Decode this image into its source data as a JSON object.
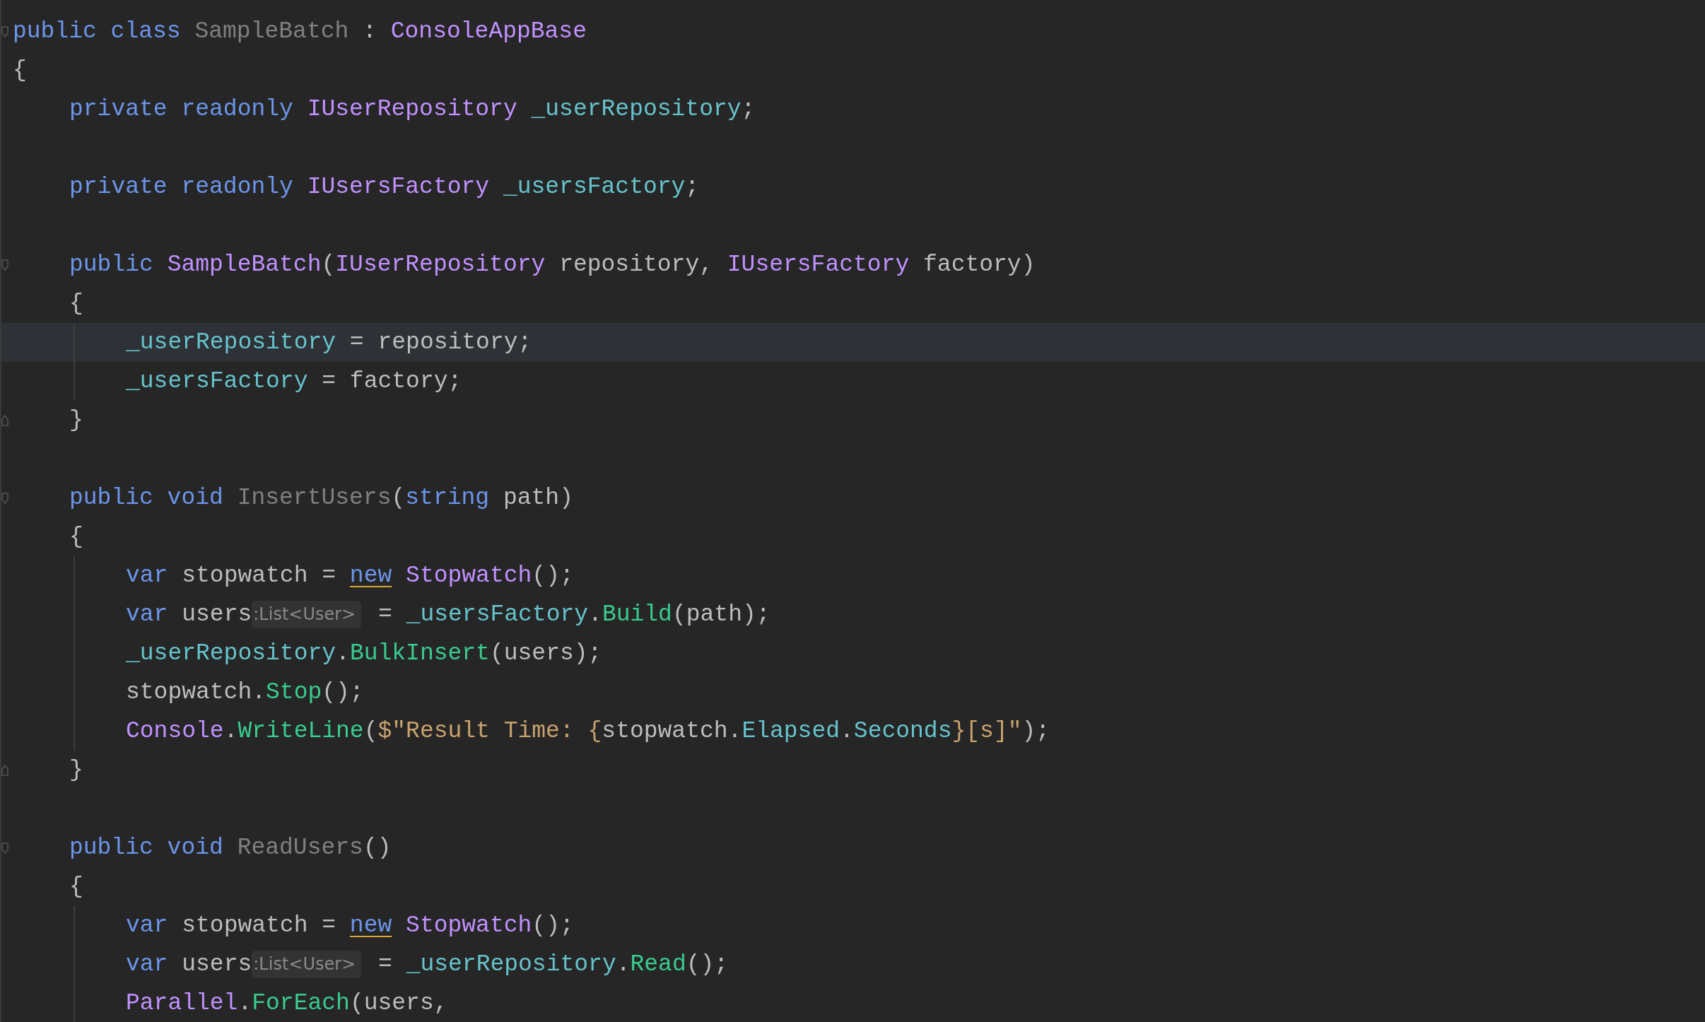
{
  "lines": [
    {
      "kind": "code",
      "fold_open": true,
      "tokens": [
        {
          "text": "public class ",
          "kind": "keyword"
        },
        {
          "text": "SampleBatch",
          "kind": "unused"
        },
        {
          "text": " : ",
          "kind": "plain"
        },
        {
          "text": "ConsoleAppBase",
          "kind": "type"
        }
      ]
    },
    {
      "kind": "code",
      "tokens": [
        {
          "text": "{",
          "kind": "plain"
        }
      ],
      "children": [
        {
          "kind": "code",
          "tokens": [
            {
              "text": "private readonly ",
              "kind": "keyword"
            },
            {
              "text": "IUserRepository ",
              "kind": "type"
            },
            {
              "text": "_userRepository",
              "kind": "field"
            },
            {
              "text": ";",
              "kind": "plain"
            }
          ]
        },
        {
          "kind": "blank"
        },
        {
          "kind": "code",
          "tokens": [
            {
              "text": "private readonly ",
              "kind": "keyword"
            },
            {
              "text": "IUsersFactory ",
              "kind": "type"
            },
            {
              "text": "_usersFactory",
              "kind": "field"
            },
            {
              "text": ";",
              "kind": "plain"
            }
          ]
        },
        {
          "kind": "blank"
        },
        {
          "kind": "code",
          "fold_open": true,
          "tokens": [
            {
              "text": "public ",
              "kind": "keyword"
            },
            {
              "text": "SampleBatch",
              "kind": "type"
            },
            {
              "text": "(",
              "kind": "plain"
            },
            {
              "text": "IUserRepository",
              "kind": "type"
            },
            {
              "text": " repository, ",
              "kind": "plain"
            },
            {
              "text": "IUsersFactory",
              "kind": "type"
            },
            {
              "text": " factory)",
              "kind": "plain"
            }
          ]
        },
        {
          "kind": "code",
          "tokens": [
            {
              "text": "{",
              "kind": "plain"
            }
          ],
          "children": [
            {
              "kind": "code",
              "selected": true,
              "tokens": [
                {
                  "text": "_userRepository",
                  "kind": "field"
                },
                {
                  "text": " = repository;",
                  "kind": "plain"
                }
              ]
            },
            {
              "kind": "code",
              "tokens": [
                {
                  "text": "_usersFactory",
                  "kind": "field"
                },
                {
                  "text": " = factory;",
                  "kind": "plain"
                }
              ]
            }
          ]
        },
        {
          "kind": "code",
          "fold_close": true,
          "tokens": [
            {
              "text": "}",
              "kind": "plain"
            }
          ]
        },
        {
          "kind": "blank"
        },
        {
          "kind": "code",
          "fold_open": true,
          "tokens": [
            {
              "text": "public void ",
              "kind": "keyword"
            },
            {
              "text": "InsertUsers",
              "kind": "unused"
            },
            {
              "text": "(",
              "kind": "plain"
            },
            {
              "text": "string",
              "kind": "keyword"
            },
            {
              "text": " path)",
              "kind": "plain"
            }
          ]
        },
        {
          "kind": "code",
          "tokens": [
            {
              "text": "{",
              "kind": "plain"
            }
          ],
          "children": [
            {
              "kind": "code",
              "tokens": [
                {
                  "text": "var ",
                  "kind": "keyword"
                },
                {
                  "text": "stopwatch = ",
                  "kind": "plain"
                },
                {
                  "text": "new",
                  "kind": "keyword",
                  "underlined": true
                },
                {
                  "text": " Stopwatch",
                  "kind": "type"
                },
                {
                  "text": "();",
                  "kind": "plain"
                }
              ]
            },
            {
              "kind": "code",
              "tokens": [
                {
                  "text": "var ",
                  "kind": "keyword"
                },
                {
                  "text": "users",
                  "kind": "plain"
                },
                {
                  "text": ":List<User>",
                  "kind": "hint"
                },
                {
                  "text": " = ",
                  "kind": "plain"
                },
                {
                  "text": "_usersFactory",
                  "kind": "field"
                },
                {
                  "text": ".",
                  "kind": "plain"
                },
                {
                  "text": "Build",
                  "kind": "method"
                },
                {
                  "text": "(path);",
                  "kind": "plain"
                }
              ]
            },
            {
              "kind": "code",
              "tokens": [
                {
                  "text": "_userRepository",
                  "kind": "field"
                },
                {
                  "text": ".",
                  "kind": "plain"
                },
                {
                  "text": "BulkInsert",
                  "kind": "method"
                },
                {
                  "text": "(users);",
                  "kind": "plain"
                }
              ]
            },
            {
              "kind": "code",
              "tokens": [
                {
                  "text": "stopwatch.",
                  "kind": "plain"
                },
                {
                  "text": "Stop",
                  "kind": "method"
                },
                {
                  "text": "();",
                  "kind": "plain"
                }
              ]
            },
            {
              "kind": "code",
              "tokens": [
                {
                  "text": "Console",
                  "kind": "type"
                },
                {
                  "text": ".",
                  "kind": "plain"
                },
                {
                  "text": "WriteLine",
                  "kind": "method"
                },
                {
                  "text": "(",
                  "kind": "plain"
                },
                {
                  "text": "$\"Result Time: {",
                  "kind": "string"
                },
                {
                  "text": "stopwatch.",
                  "kind": "plain"
                },
                {
                  "text": "Elapsed",
                  "kind": "field"
                },
                {
                  "text": ".",
                  "kind": "plain"
                },
                {
                  "text": "Seconds",
                  "kind": "field"
                },
                {
                  "text": "}[s]\"",
                  "kind": "string"
                },
                {
                  "text": ");",
                  "kind": "plain"
                }
              ]
            }
          ]
        },
        {
          "kind": "code",
          "fold_close": true,
          "tokens": [
            {
              "text": "}",
              "kind": "plain"
            }
          ]
        },
        {
          "kind": "blank"
        },
        {
          "kind": "code",
          "fold_open": true,
          "tokens": [
            {
              "text": "public void ",
              "kind": "keyword"
            },
            {
              "text": "ReadUsers",
              "kind": "unused"
            },
            {
              "text": "()",
              "kind": "plain"
            }
          ]
        },
        {
          "kind": "code",
          "tokens": [
            {
              "text": "{",
              "kind": "plain"
            }
          ],
          "children": [
            {
              "kind": "code",
              "tokens": [
                {
                  "text": "var ",
                  "kind": "keyword"
                },
                {
                  "text": "stopwatch = ",
                  "kind": "plain"
                },
                {
                  "text": "new",
                  "kind": "keyword",
                  "underlined": true
                },
                {
                  "text": " Stopwatch",
                  "kind": "type"
                },
                {
                  "text": "();",
                  "kind": "plain"
                }
              ]
            },
            {
              "kind": "code",
              "tokens": [
                {
                  "text": "var ",
                  "kind": "keyword"
                },
                {
                  "text": "users",
                  "kind": "plain"
                },
                {
                  "text": ":List<User>",
                  "kind": "hint"
                },
                {
                  "text": " = ",
                  "kind": "plain"
                },
                {
                  "text": "_userRepository",
                  "kind": "field"
                },
                {
                  "text": ".",
                  "kind": "plain"
                },
                {
                  "text": "Read",
                  "kind": "method"
                },
                {
                  "text": "();",
                  "kind": "plain"
                }
              ]
            },
            {
              "kind": "code",
              "tokens": [
                {
                  "text": "Parallel",
                  "kind": "type"
                },
                {
                  "text": ".",
                  "kind": "plain"
                },
                {
                  "text": "ForEach",
                  "kind": "method"
                },
                {
                  "text": "(users,",
                  "kind": "plain"
                }
              ]
            }
          ]
        }
      ]
    }
  ]
}
